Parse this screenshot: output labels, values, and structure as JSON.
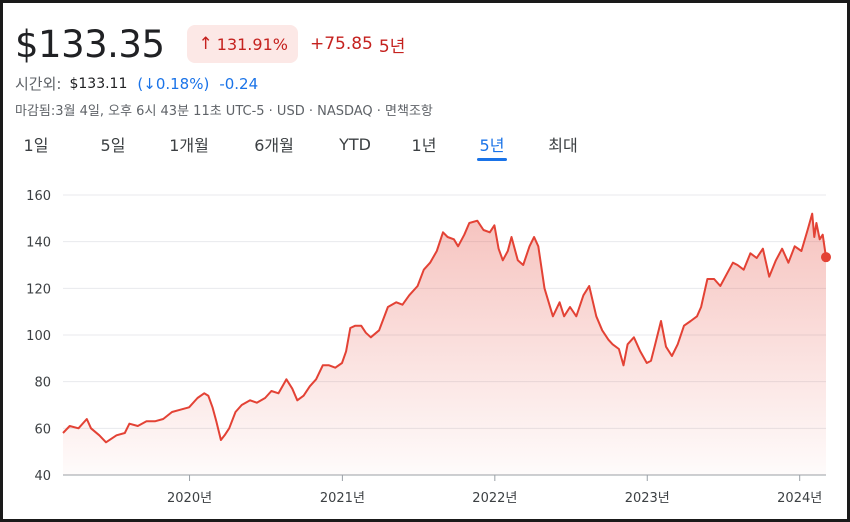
{
  "quote": {
    "price": "$133.35",
    "change_pct": "131.91%",
    "change_abs": "+75.85",
    "change_period": "5년",
    "up_icon": "arrow-up-icon"
  },
  "after_hours": {
    "label": "시간외:",
    "price": "$133.11",
    "pct": "0.18%",
    "change": "-0.24",
    "down_icon": "arrow-down-icon"
  },
  "meta": "마감됨:3월 4일, 오후 6시 43분 11초 UTC-5 · USD · NASDAQ · 면책조항",
  "tabs": [
    {
      "label": "1일",
      "active": false
    },
    {
      "label": "5일",
      "active": false
    },
    {
      "label": "1개월",
      "active": false
    },
    {
      "label": "6개월",
      "active": false
    },
    {
      "label": "YTD",
      "active": false
    },
    {
      "label": "1년",
      "active": false
    },
    {
      "label": "5년",
      "active": true
    },
    {
      "label": "최대",
      "active": false
    }
  ],
  "colors": {
    "down_red": "#c5221f",
    "line": "#e34235",
    "accent_blue": "#1a73e8",
    "badge_bg": "#fce8e6"
  },
  "chart_data": {
    "type": "area",
    "yticks": [
      40,
      60,
      80,
      100,
      120,
      140,
      160
    ],
    "ylim": [
      40,
      160
    ],
    "xticks": [
      "2020년",
      "2021년",
      "2022년",
      "2023년",
      "2024년"
    ],
    "xtick_dates": [
      "2020-01-01",
      "2021-01-01",
      "2022-01-01",
      "2023-01-01",
      "2024-01-01"
    ],
    "x_range": [
      "2019-03-04",
      "2024-03-04"
    ],
    "grid": true,
    "series": [
      {
        "values": [
          [
            "2019-03-04",
            58
          ],
          [
            "2019-03-20",
            61
          ],
          [
            "2019-04-10",
            60
          ],
          [
            "2019-04-30",
            64
          ],
          [
            "2019-05-10",
            60
          ],
          [
            "2019-05-30",
            57
          ],
          [
            "2019-06-15",
            54
          ],
          [
            "2019-07-10",
            57
          ],
          [
            "2019-07-30",
            58
          ],
          [
            "2019-08-10",
            62
          ],
          [
            "2019-08-30",
            61
          ],
          [
            "2019-09-20",
            63
          ],
          [
            "2019-10-10",
            63
          ],
          [
            "2019-10-30",
            64
          ],
          [
            "2019-11-20",
            67
          ],
          [
            "2019-12-10",
            68
          ],
          [
            "2019-12-31",
            69
          ],
          [
            "2020-01-20",
            73
          ],
          [
            "2020-02-05",
            75
          ],
          [
            "2020-02-15",
            74
          ],
          [
            "2020-02-25",
            69
          ],
          [
            "2020-03-05",
            63
          ],
          [
            "2020-03-16",
            55
          ],
          [
            "2020-03-25",
            57
          ],
          [
            "2020-04-05",
            60
          ],
          [
            "2020-04-20",
            67
          ],
          [
            "2020-05-05",
            70
          ],
          [
            "2020-05-25",
            72
          ],
          [
            "2020-06-10",
            71
          ],
          [
            "2020-06-30",
            73
          ],
          [
            "2020-07-15",
            76
          ],
          [
            "2020-08-01",
            75
          ],
          [
            "2020-08-20",
            81
          ],
          [
            "2020-09-03",
            77
          ],
          [
            "2020-09-15",
            72
          ],
          [
            "2020-09-30",
            74
          ],
          [
            "2020-10-15",
            78
          ],
          [
            "2020-10-30",
            81
          ],
          [
            "2020-11-15",
            87
          ],
          [
            "2020-11-30",
            87
          ],
          [
            "2020-12-15",
            86
          ],
          [
            "2020-12-31",
            88
          ],
          [
            "2021-01-10",
            93
          ],
          [
            "2021-01-20",
            103
          ],
          [
            "2021-02-01",
            104
          ],
          [
            "2021-02-15",
            104
          ],
          [
            "2021-02-26",
            101
          ],
          [
            "2021-03-10",
            99
          ],
          [
            "2021-03-30",
            102
          ],
          [
            "2021-04-20",
            112
          ],
          [
            "2021-05-10",
            114
          ],
          [
            "2021-05-25",
            113
          ],
          [
            "2021-06-10",
            117
          ],
          [
            "2021-06-30",
            121
          ],
          [
            "2021-07-15",
            128
          ],
          [
            "2021-07-30",
            131
          ],
          [
            "2021-08-15",
            136
          ],
          [
            "2021-08-30",
            144
          ],
          [
            "2021-09-10",
            142
          ],
          [
            "2021-09-25",
            141
          ],
          [
            "2021-10-05",
            138
          ],
          [
            "2021-10-20",
            143
          ],
          [
            "2021-11-01",
            148
          ],
          [
            "2021-11-20",
            149
          ],
          [
            "2021-12-05",
            145
          ],
          [
            "2021-12-20",
            144
          ],
          [
            "2021-12-31",
            147
          ],
          [
            "2022-01-10",
            137
          ],
          [
            "2022-01-20",
            132
          ],
          [
            "2022-02-01",
            136
          ],
          [
            "2022-02-10",
            142
          ],
          [
            "2022-02-25",
            132
          ],
          [
            "2022-03-10",
            130
          ],
          [
            "2022-03-25",
            138
          ],
          [
            "2022-04-05",
            142
          ],
          [
            "2022-04-15",
            138
          ],
          [
            "2022-04-30",
            120
          ],
          [
            "2022-05-10",
            114
          ],
          [
            "2022-05-20",
            108
          ],
          [
            "2022-06-05",
            114
          ],
          [
            "2022-06-16",
            108
          ],
          [
            "2022-06-30",
            112
          ],
          [
            "2022-07-15",
            108
          ],
          [
            "2022-08-01",
            117
          ],
          [
            "2022-08-15",
            121
          ],
          [
            "2022-09-01",
            108
          ],
          [
            "2022-09-15",
            102
          ],
          [
            "2022-09-30",
            98
          ],
          [
            "2022-10-10",
            96
          ],
          [
            "2022-10-25",
            94
          ],
          [
            "2022-11-05",
            87
          ],
          [
            "2022-11-15",
            96
          ],
          [
            "2022-11-30",
            99
          ],
          [
            "2022-12-15",
            93
          ],
          [
            "2022-12-31",
            88
          ],
          [
            "2023-01-10",
            89
          ],
          [
            "2023-01-20",
            96
          ],
          [
            "2023-02-03",
            106
          ],
          [
            "2023-02-15",
            95
          ],
          [
            "2023-03-01",
            91
          ],
          [
            "2023-03-15",
            96
          ],
          [
            "2023-03-30",
            104
          ],
          [
            "2023-04-15",
            106
          ],
          [
            "2023-04-30",
            108
          ],
          [
            "2023-05-10",
            112
          ],
          [
            "2023-05-25",
            124
          ],
          [
            "2023-06-10",
            124
          ],
          [
            "2023-06-25",
            121
          ],
          [
            "2023-07-10",
            126
          ],
          [
            "2023-07-25",
            131
          ],
          [
            "2023-08-05",
            130
          ],
          [
            "2023-08-20",
            128
          ],
          [
            "2023-09-05",
            135
          ],
          [
            "2023-09-20",
            133
          ],
          [
            "2023-10-05",
            137
          ],
          [
            "2023-10-20",
            125
          ],
          [
            "2023-11-05",
            132
          ],
          [
            "2023-11-20",
            137
          ],
          [
            "2023-12-05",
            131
          ],
          [
            "2023-12-20",
            138
          ],
          [
            "2024-01-05",
            136
          ],
          [
            "2024-01-20",
            145
          ],
          [
            "2024-01-31",
            152
          ],
          [
            "2024-02-05",
            142
          ],
          [
            "2024-02-10",
            148
          ],
          [
            "2024-02-18",
            141
          ],
          [
            "2024-02-25",
            143
          ],
          [
            "2024-03-04",
            133.35
          ]
        ]
      }
    ],
    "last_point": [
      "2024-03-04",
      133.35
    ]
  }
}
